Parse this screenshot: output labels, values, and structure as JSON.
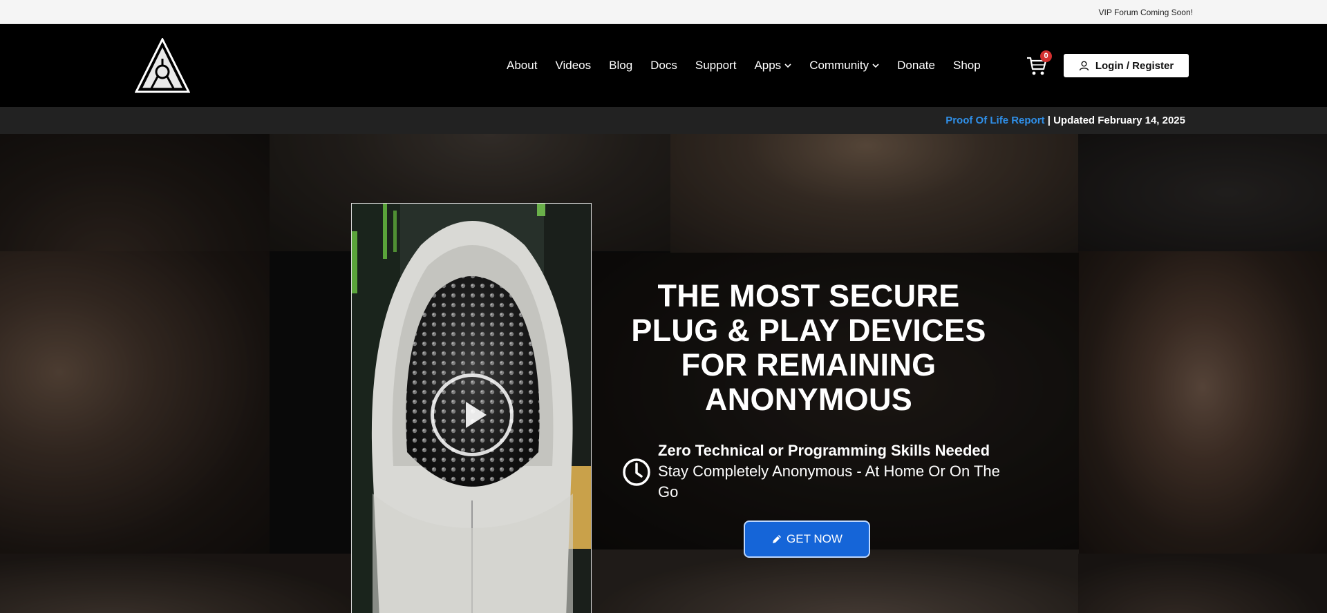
{
  "topbar": {
    "announcement": "VIP Forum Coming Soon!"
  },
  "header": {
    "logo_icon": "illuminati-triangle-icon",
    "nav": [
      {
        "label": "About",
        "dropdown": false
      },
      {
        "label": "Videos",
        "dropdown": false
      },
      {
        "label": "Blog",
        "dropdown": false
      },
      {
        "label": "Docs",
        "dropdown": false
      },
      {
        "label": "Support",
        "dropdown": false
      },
      {
        "label": "Apps",
        "dropdown": true
      },
      {
        "label": "Community",
        "dropdown": true
      },
      {
        "label": "Donate",
        "dropdown": false
      },
      {
        "label": "Shop",
        "dropdown": false
      }
    ],
    "cart_count": "0",
    "login_label": "Login / Register"
  },
  "infobar": {
    "report_link": "Proof Of Life Report",
    "updated_text": "| Updated February 14, 2025",
    "link_color": "#2f8fe8"
  },
  "hero": {
    "headline": [
      "THE MOST SECURE",
      "PLUG & PLAY DEVICES",
      "FOR REMAINING",
      "ANONYMOUS"
    ],
    "feature_title": "Zero Technical or Programming Skills Needed",
    "feature_desc": "Stay Completely Anonymous - At Home Or On The Go",
    "cta_label": "GET NOW",
    "cta_color": "#1565d8"
  }
}
